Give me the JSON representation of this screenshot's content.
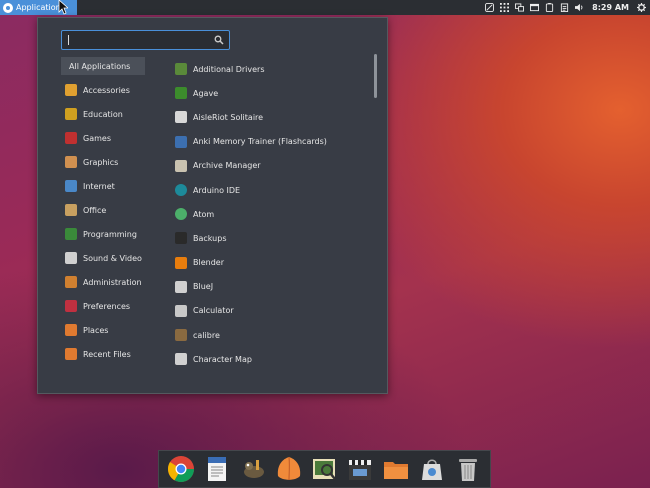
{
  "top_panel": {
    "applications_label": "Applications",
    "clock": "8:29 AM",
    "tray_icons": [
      "no-entry-icon",
      "grid-icon",
      "display-icon",
      "window-icon",
      "battery-icon",
      "clipboard-icon",
      "volume-icon",
      "gear-icon"
    ]
  },
  "menu": {
    "search": {
      "value": "",
      "placeholder": ""
    },
    "categories": [
      {
        "label": "All Applications",
        "icon": "all-apps",
        "active": true
      },
      {
        "label": "Accessories",
        "icon": "accessories-icon"
      },
      {
        "label": "Education",
        "icon": "education-icon"
      },
      {
        "label": "Games",
        "icon": "games-icon"
      },
      {
        "label": "Graphics",
        "icon": "graphics-icon"
      },
      {
        "label": "Internet",
        "icon": "internet-icon"
      },
      {
        "label": "Office",
        "icon": "office-icon"
      },
      {
        "label": "Programming",
        "icon": "programming-icon"
      },
      {
        "label": "Sound & Video",
        "icon": "sound-video-icon"
      },
      {
        "label": "Administration",
        "icon": "administration-icon"
      },
      {
        "label": "Preferences",
        "icon": "preferences-icon"
      },
      {
        "label": "Places",
        "icon": "places-icon"
      },
      {
        "label": "Recent Files",
        "icon": "recent-files-icon"
      }
    ],
    "apps": [
      {
        "label": "Additional Drivers",
        "icon": "drivers-icon",
        "color": "#5a8a3a"
      },
      {
        "label": "Agave",
        "icon": "agave-icon",
        "color": "#3c8c2c"
      },
      {
        "label": "AisleRiot Solitaire",
        "icon": "cards-icon",
        "color": "#d8d8d8"
      },
      {
        "label": "Anki Memory Trainer (Flashcards)",
        "icon": "anki-icon",
        "color": "#3c6fb0"
      },
      {
        "label": "Archive Manager",
        "icon": "archive-icon",
        "color": "#c9c2b0"
      },
      {
        "label": "Arduino IDE",
        "icon": "arduino-icon",
        "color": "#1d8a9a"
      },
      {
        "label": "Atom",
        "icon": "atom-icon",
        "color": "#4caf6a"
      },
      {
        "label": "Backups",
        "icon": "backups-icon",
        "color": "#2a2a2a"
      },
      {
        "label": "Blender",
        "icon": "blender-icon",
        "color": "#e87d0d"
      },
      {
        "label": "BlueJ",
        "icon": "bluej-icon",
        "color": "#d0d0d0"
      },
      {
        "label": "Calculator",
        "icon": "calculator-icon",
        "color": "#c8c8c8"
      },
      {
        "label": "calibre",
        "icon": "calibre-icon",
        "color": "#8a6a40"
      },
      {
        "label": "Character Map",
        "icon": "character-map-icon",
        "color": "#d0d0d0"
      }
    ]
  },
  "dock": {
    "items": [
      "chrome-icon",
      "document-viewer-icon",
      "gimp-icon",
      "sublime-icon",
      "image-viewer-icon",
      "video-editor-icon",
      "files-icon",
      "software-center-icon",
      "trash-icon"
    ]
  }
}
